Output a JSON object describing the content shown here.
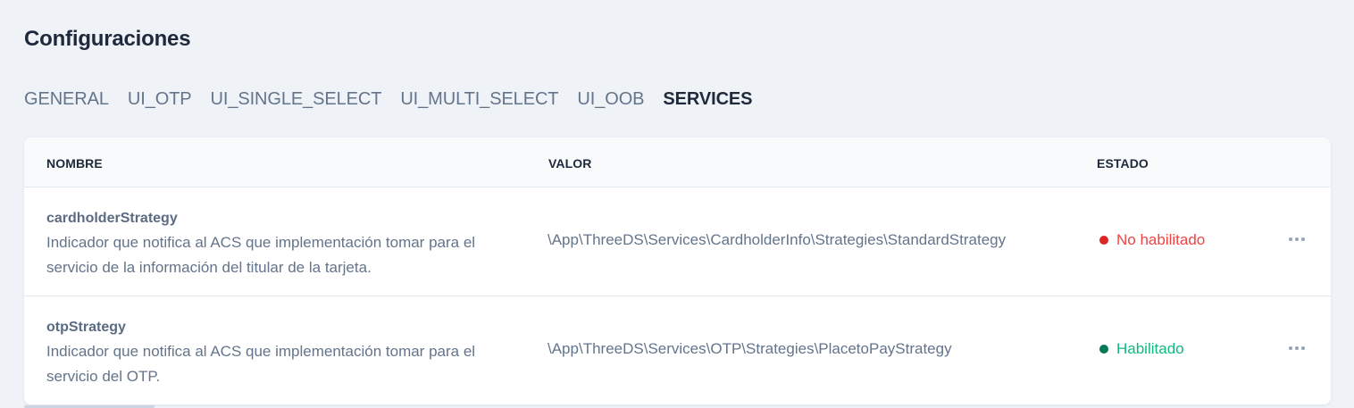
{
  "page": {
    "title": "Configuraciones"
  },
  "tabs": [
    {
      "label": "GENERAL",
      "active": false
    },
    {
      "label": "UI_OTP",
      "active": false
    },
    {
      "label": "UI_SINGLE_SELECT",
      "active": false
    },
    {
      "label": "UI_MULTI_SELECT",
      "active": false
    },
    {
      "label": "UI_OOB",
      "active": false
    },
    {
      "label": "SERVICES",
      "active": true
    }
  ],
  "table": {
    "headers": {
      "name": "NOMBRE",
      "value": "VALOR",
      "status": "ESTADO"
    },
    "rows": [
      {
        "name": "cardholderStrategy",
        "description": "Indicador que notifica al ACS que implementación tomar para el servicio de la información del titular de la tarjeta.",
        "value": "\\App\\ThreeDS\\Services\\CardholderInfo\\Strategies\\StandardStrategy",
        "status": "No habilitado",
        "status_color": "#ef4444",
        "actions_icon": "more-horizontal-icon"
      },
      {
        "name": "otpStrategy",
        "description": "Indicador que notifica al ACS que implementación tomar para el servicio del OTP.",
        "value": "\\App\\ThreeDS\\Services\\OTP\\Strategies\\PlacetoPayStrategy",
        "status": "Habilitado",
        "status_color": "#10b981",
        "actions_icon": "more-horizontal-icon"
      }
    ]
  }
}
